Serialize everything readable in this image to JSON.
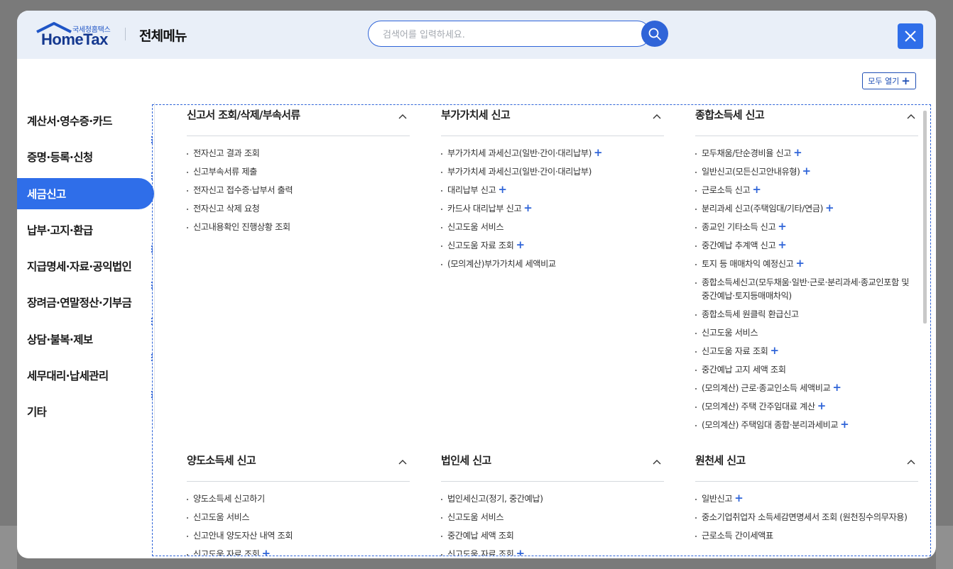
{
  "header": {
    "logo_sub": "국세청홈택스",
    "logo_main": "HomeTax",
    "title": "전체메뉴",
    "search_placeholder": "검색어를 입력하세요.",
    "icons": {
      "search": "search-icon",
      "close": "close-icon",
      "collapse": "chevron-up-icon"
    }
  },
  "colors": {
    "accent": "#2f6ee9",
    "header_bg": "#e9eff8",
    "plus": "#2f64d8"
  },
  "expand_all": {
    "label": "모두 열기",
    "icon": "+"
  },
  "sidebar": {
    "active_index": 2,
    "items": [
      {
        "label": "계산서·영수증·카드"
      },
      {
        "label": "증명·등록·신청"
      },
      {
        "label": "세금신고"
      },
      {
        "label": "납부·고지·환급"
      },
      {
        "label": "지급명세·자료·공익법인"
      },
      {
        "label": "장려금·연말정산·기부금"
      },
      {
        "label": "상담·불복·제보"
      },
      {
        "label": "세무대리·납세관리"
      },
      {
        "label": "기타"
      }
    ]
  },
  "sections": [
    {
      "title": "신고서 조회/삭제/부속서류",
      "items": [
        {
          "label": "전자신고 결과 조회",
          "plus": false
        },
        {
          "label": "신고부속서류 제출",
          "plus": false
        },
        {
          "label": "전자신고 접수증·납부서 출력",
          "plus": false
        },
        {
          "label": "전자신고 삭제 요청",
          "plus": false
        },
        {
          "label": "신고내용확인 진행상황 조회",
          "plus": false
        }
      ]
    },
    {
      "title": "부가가치세 신고",
      "items": [
        {
          "label": "부가가치세 과세신고(일반·간이·대리납부)",
          "plus": true
        },
        {
          "label": "부가가치세 과세신고(일반·간이·대리납부)",
          "plus": false
        },
        {
          "label": "대리납부 신고",
          "plus": true
        },
        {
          "label": "카드사 대리납부 신고",
          "plus": true
        },
        {
          "label": "신고도움 서비스",
          "plus": false
        },
        {
          "label": "신고도움 자료 조회",
          "plus": true
        },
        {
          "label": "(모의계산)부가가치세 세액비교",
          "plus": false
        }
      ]
    },
    {
      "title": "종합소득세 신고",
      "items": [
        {
          "label": "모두채움/단순경비율 신고",
          "plus": true
        },
        {
          "label": "일반신고(모든신고안내유형)",
          "plus": true
        },
        {
          "label": "근로소득 신고",
          "plus": true
        },
        {
          "label": "분리과세 신고(주택임대/기타/연금)",
          "plus": true
        },
        {
          "label": "종교인 기타소득 신고",
          "plus": true
        },
        {
          "label": "중간예납 추계액 신고",
          "plus": true
        },
        {
          "label": "토지 등 매매차익 예정신고",
          "plus": true
        },
        {
          "label": "종합소득세신고(모두채움·일반·근로·분리과세·종교인포함 및 중간예납·토지등매매차익)",
          "plus": false
        },
        {
          "label": "종합소득세 원클릭 환급신고",
          "plus": false
        },
        {
          "label": "신고도움 서비스",
          "plus": false
        },
        {
          "label": "신고도움 자료 조회",
          "plus": true
        },
        {
          "label": "중간예납 고지 세액 조회",
          "plus": false
        },
        {
          "label": "(모의계산) 근로·종교인소득 세액비교",
          "plus": true
        },
        {
          "label": "(모의계산) 주택 간주임대료 계산",
          "plus": true
        },
        {
          "label": "(모의계산) 주택임대 종합·분리과세비교",
          "plus": true
        }
      ]
    },
    {
      "title": "양도소득세 신고",
      "items": [
        {
          "label": "양도소득세 신고하기",
          "plus": false
        },
        {
          "label": "신고도움 서비스",
          "plus": false
        },
        {
          "label": "신고안내 양도자산 내역 조회",
          "plus": false
        },
        {
          "label": "신고도움 자료 조회",
          "plus": true
        }
      ]
    },
    {
      "title": "법인세 신고",
      "items": [
        {
          "label": "법인세신고(정기, 중간예납)",
          "plus": false
        },
        {
          "label": "신고도움 서비스",
          "plus": false
        },
        {
          "label": "중간예납 세액 조회",
          "plus": false
        },
        {
          "label": "신고도움 자료 조회",
          "plus": true
        }
      ]
    },
    {
      "title": "원천세 신고",
      "items": [
        {
          "label": "일반신고",
          "plus": true
        },
        {
          "label": "중소기업취업자 소득세감면명세서 조회 (원천징수의무자용)",
          "plus": false
        },
        {
          "label": "근로소득 간이세액표",
          "plus": false
        }
      ]
    }
  ]
}
